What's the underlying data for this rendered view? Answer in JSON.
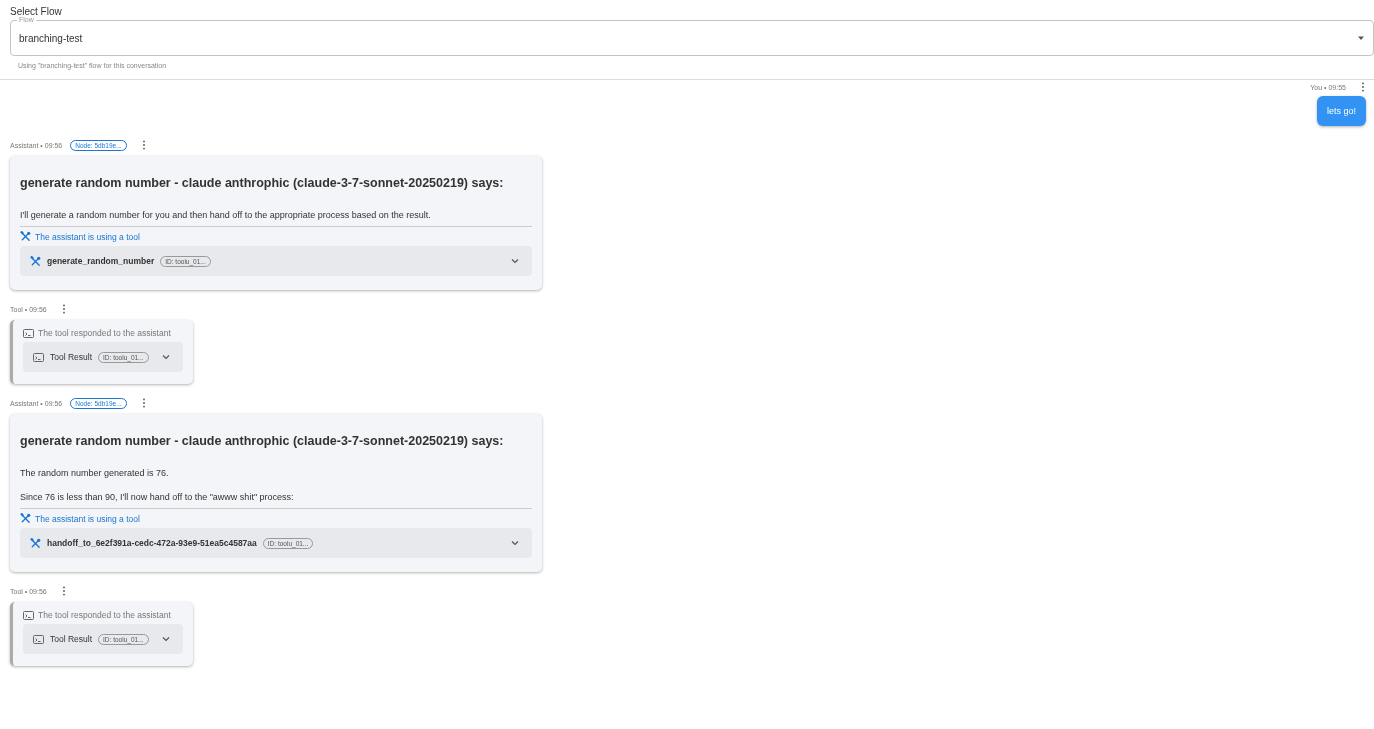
{
  "header": {
    "title": "Select Flow",
    "field_label": "Flow",
    "value": "branching-test",
    "helper": "Using \"branching-test\" flow for this conversation"
  },
  "messages": [
    {
      "kind": "user",
      "meta": "You • 09:55",
      "text": "lets go!"
    },
    {
      "kind": "assistant",
      "meta": "Assistant • 09:56",
      "node": "Node: 5db19e...",
      "title": "generate random number - claude anthrophic (claude-3-7-sonnet-20250219) says:",
      "paragraphs": [
        "I'll generate a random number for you and then hand off to the appropriate process based on the result."
      ],
      "tool_notice": "The assistant is using a tool",
      "tool_name": "generate_random_number",
      "tool_id": "ID: toolu_01...",
      "expanded": false
    },
    {
      "kind": "tool",
      "meta": "Tool • 09:56",
      "notice": "The tool responded to the assistant",
      "result_label": "Tool Result",
      "tool_id": "ID: toolu_01...",
      "expanded": false
    },
    {
      "kind": "assistant",
      "meta": "Assistant • 09:56",
      "node": "Node: 5db19e...",
      "title": "generate random number - claude anthrophic (claude-3-7-sonnet-20250219) says:",
      "paragraphs": [
        "The random number generated is 76.",
        "Since 76 is less than 90, I'll now hand off to the \"awww shit\" process:"
      ],
      "tool_notice": "The assistant is using a tool",
      "tool_name": "handoff_to_6e2f391a-cedc-472a-93e9-51ea5c4587aa",
      "tool_id": "ID: toolu_01...",
      "expanded": false
    },
    {
      "kind": "tool",
      "meta": "Tool • 09:56",
      "notice": "The tool responded to the assistant",
      "result_label": "Tool Result",
      "tool_id": "ID: toolu_01...",
      "expanded": false
    }
  ]
}
